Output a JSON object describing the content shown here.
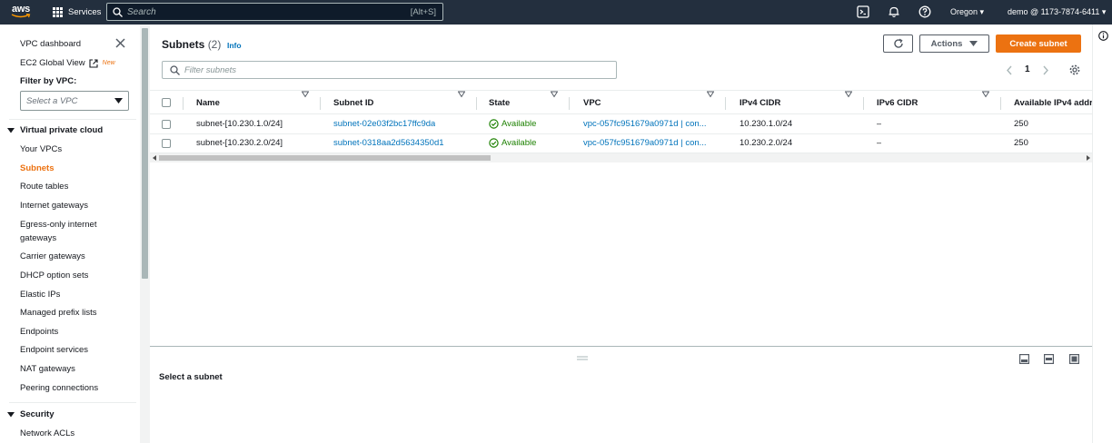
{
  "topnav": {
    "logo_text": "aws",
    "services_label": "Services",
    "search_placeholder": "Search",
    "search_shortcut": "[Alt+S]",
    "region": "Oregon ▾",
    "account": "demo @ 1173-7874-6411 ▾"
  },
  "sidebar": {
    "dashboard": "VPC dashboard",
    "ec2_global_view": "EC2 Global View",
    "new_badge": "New",
    "filter_label": "Filter by VPC:",
    "filter_placeholder": "Select a VPC",
    "section_vpc": "Virtual private cloud",
    "items": [
      "Your VPCs",
      "Subnets",
      "Route tables",
      "Internet gateways",
      "Egress-only internet",
      "gateways",
      "Carrier gateways",
      "DHCP option sets",
      "Elastic IPs",
      "Managed prefix lists",
      "Endpoints",
      "Endpoint services",
      "NAT gateways",
      "Peering connections"
    ],
    "section_security": "Security",
    "security_items": [
      "Network ACLs"
    ]
  },
  "main": {
    "title": "Subnets",
    "count": "(2)",
    "info": "Info",
    "actions_label": "Actions",
    "create_label": "Create subnet",
    "filter_placeholder": "Filter subnets",
    "page_number": "1",
    "columns": [
      "Name",
      "Subnet ID",
      "State",
      "VPC",
      "IPv4 CIDR",
      "IPv6 CIDR",
      "Available IPv4 addr"
    ],
    "rows": [
      {
        "name": "subnet-[10.230.1.0/24]",
        "subnet_id": "subnet-02e03f2bc17ffc9da",
        "state": "Available",
        "vpc": "vpc-057fc951679a0971d | con...",
        "ipv4": "10.230.1.0/24",
        "ipv6": "–",
        "available": "250"
      },
      {
        "name": "subnet-[10.230.2.0/24]",
        "subnet_id": "subnet-0318aa2d5634350d1",
        "state": "Available",
        "vpc": "vpc-057fc951679a0971d | con...",
        "ipv4": "10.230.2.0/24",
        "ipv6": "–",
        "available": "250"
      }
    ],
    "split_prompt": "Select a subnet"
  },
  "colors": {
    "nav_bg": "#232f3e",
    "accent": "#ec7211",
    "link": "#0073bb",
    "success": "#1d8102"
  },
  "icons": [
    "grid-icon",
    "search-icon",
    "cloudshell-icon",
    "bell-icon",
    "help-icon",
    "external-link-icon",
    "close-icon",
    "refresh-icon",
    "settings-icon",
    "check-circle-icon",
    "info-icon"
  ]
}
